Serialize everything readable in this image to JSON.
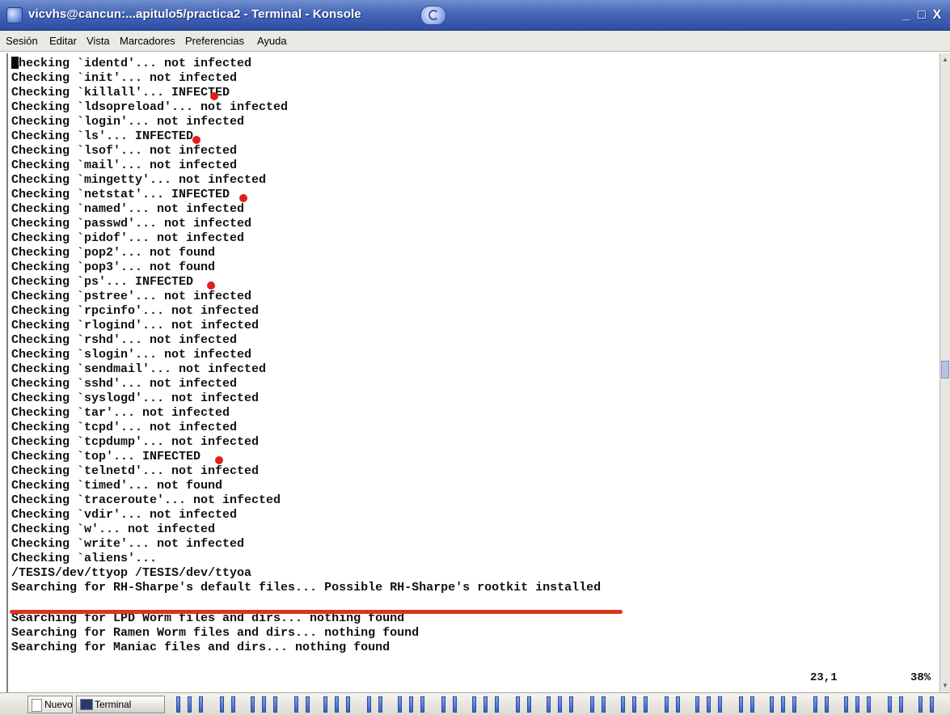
{
  "window": {
    "title": "vicvhs@cancun:...apitulo5/practica2 - Terminal - Konsole",
    "minimize_label": "_",
    "maximize_label": "□",
    "close_label": "X"
  },
  "menu": {
    "items": [
      "Sesión",
      "Editar",
      "Vista",
      "Marcadores",
      "Preferencias",
      "Ayuda"
    ]
  },
  "terminal": {
    "lines": [
      "Checking `identd'... not infected",
      "Checking `init'... not infected",
      "Checking `killall'... INFECTED",
      "Checking `ldsopreload'... not infected",
      "Checking `login'... not infected",
      "Checking `ls'... INFECTED",
      "Checking `lsof'... not infected",
      "Checking `mail'... not infected",
      "Checking `mingetty'... not infected",
      "Checking `netstat'... INFECTED",
      "Checking `named'... not infected",
      "Checking `passwd'... not infected",
      "Checking `pidof'... not infected",
      "Checking `pop2'... not found",
      "Checking `pop3'... not found",
      "Checking `ps'... INFECTED",
      "Checking `pstree'... not infected",
      "Checking `rpcinfo'... not infected",
      "Checking `rlogind'... not infected",
      "Checking `rshd'... not infected",
      "Checking `slogin'... not infected",
      "Checking `sendmail'... not infected",
      "Checking `sshd'... not infected",
      "Checking `syslogd'... not infected",
      "Checking `tar'... not infected",
      "Checking `tcpd'... not infected",
      "Checking `tcpdump'... not infected",
      "Checking `top'... INFECTED",
      "Checking `telnetd'... not infected",
      "Checking `timed'... not found",
      "Checking `traceroute'... not infected",
      "Checking `vdir'... not infected",
      "Checking `w'... not infected",
      "Checking `write'... not infected",
      "Checking `aliens'...",
      "/TESIS/dev/ttyop /TESIS/dev/ttyoa",
      "Searching for RH-Sharpe's default files... Possible RH-Sharpe's rootkit installed",
      "",
      "Searching for LPD Worm files and dirs... nothing found",
      "Searching for Ramen Worm files and dirs... nothing found",
      "Searching for Maniac files and dirs... nothing found"
    ],
    "infected_marker_color": "#e0201b",
    "cursor_position": "23,1",
    "scroll_percent": "38%"
  },
  "taskbar": {
    "new_button_label": "Nuevo",
    "terminal_button_label": "Terminal",
    "pager_color": "#3b63c5"
  }
}
